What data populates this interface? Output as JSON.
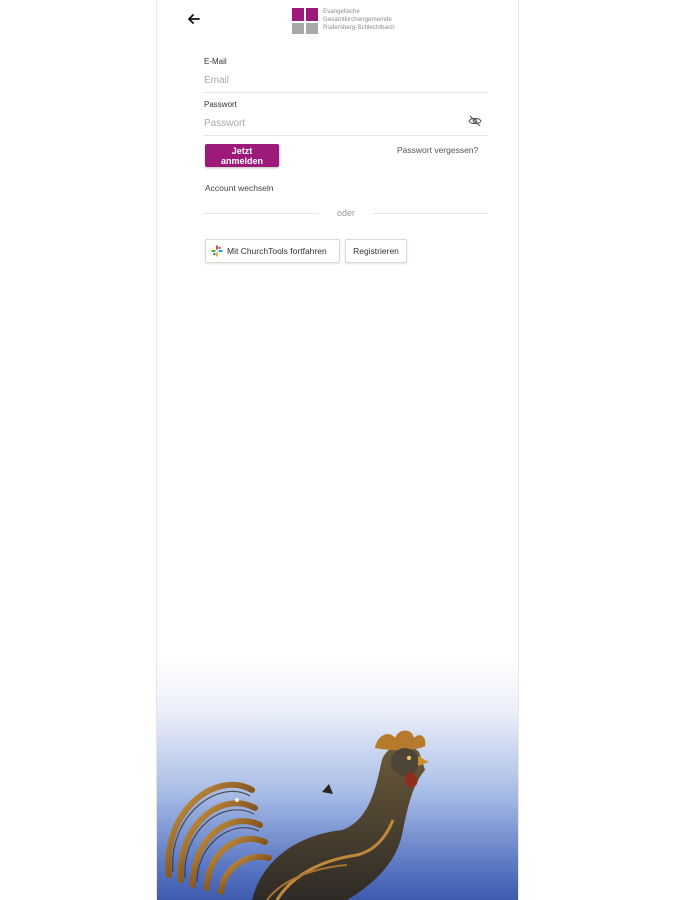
{
  "header": {
    "logo_lines": [
      "Evangelische",
      "Gesamtkirchengemeinde",
      "Rudersberg-Schlechtbach"
    ]
  },
  "form": {
    "email_label": "E-Mail",
    "email_placeholder": "Email",
    "password_label": "Passwort",
    "password_placeholder": "Passwort",
    "login_button": "Jetzt anmelden",
    "forgot_link": "Passwort vergessen?",
    "switch_account": "Account wechseln",
    "divider_text": "oder",
    "churchtools_button": "Mit ChurchTools fortfahren",
    "register_button": "Registrieren"
  },
  "colors": {
    "accent": "#9e1a7a",
    "sky_top": "#e9eef9",
    "sky_bottom": "#3e5aae"
  },
  "icons": {
    "back": "arrow-left-icon",
    "password_visibility": "eye-off-icon",
    "churchtools": "churchtools-logo-icon"
  }
}
